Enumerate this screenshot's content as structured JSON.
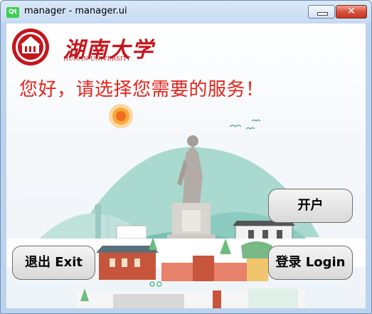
{
  "window": {
    "app_icon_text": "Qt",
    "title": "manager - manager.ui",
    "minimize_symbol": "",
    "close_symbol": "✕"
  },
  "logo": {
    "university_name_cn": "湖南大学",
    "university_name_en": "HUNAN UNIVERSITY",
    "color": "#c4161c"
  },
  "greeting": "您好，请选择您需要的服务！",
  "buttons": {
    "open_account": "开户",
    "exit": "退出 Exit",
    "login": "登录 Login"
  },
  "colors": {
    "greeting": "#e5231c",
    "sun": "#f39a2e",
    "hill": "#8ccbc0"
  }
}
